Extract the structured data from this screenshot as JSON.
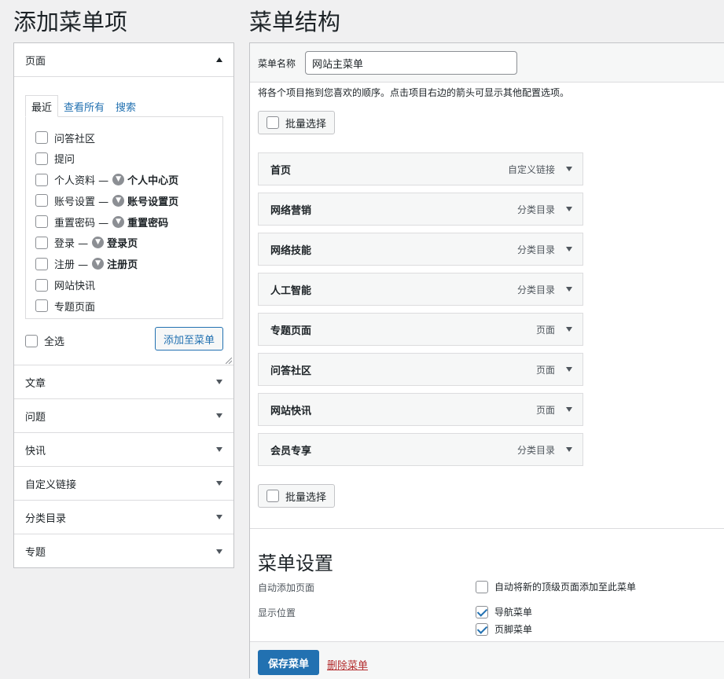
{
  "left": {
    "title": "添加菜单项",
    "pages_section": {
      "heading": "页面",
      "tabs": [
        "最近",
        "查看所有",
        "搜索"
      ],
      "items": [
        {
          "label": "问答社区",
          "checked": false,
          "suffix": ""
        },
        {
          "label": "提问",
          "checked": false,
          "suffix": ""
        },
        {
          "label": "个人资料 —",
          "checked": false,
          "suffix": "个人中心页"
        },
        {
          "label": "账号设置 —",
          "checked": false,
          "suffix": "账号设置页"
        },
        {
          "label": "重置密码 —",
          "checked": false,
          "suffix": "重置密码"
        },
        {
          "label": "登录 —",
          "checked": false,
          "suffix": "登录页"
        },
        {
          "label": "注册 —",
          "checked": false,
          "suffix": "注册页"
        },
        {
          "label": "网站快讯",
          "checked": false,
          "suffix": ""
        },
        {
          "label": "专题页面",
          "checked": false,
          "suffix": ""
        }
      ],
      "select_all": "全选",
      "add_button": "添加至菜单"
    },
    "other_sections": [
      "文章",
      "问题",
      "快讯",
      "自定义链接",
      "分类目录",
      "专题"
    ]
  },
  "right": {
    "title": "菜单结构",
    "menu_name_label": "菜单名称",
    "menu_name_value": "网站主菜单",
    "instructions": "将各个项目拖到您喜欢的顺序。点击项目右边的箭头可显示其他配置选项。",
    "bulk_select": "批量选择",
    "menu_items": [
      {
        "title": "首页",
        "type": "自定义链接"
      },
      {
        "title": "网络营销",
        "type": "分类目录"
      },
      {
        "title": "网络技能",
        "type": "分类目录"
      },
      {
        "title": "人工智能",
        "type": "分类目录"
      },
      {
        "title": "专题页面",
        "type": "页面"
      },
      {
        "title": "问答社区",
        "type": "页面"
      },
      {
        "title": "网站快讯",
        "type": "页面"
      },
      {
        "title": "会员专享",
        "type": "分类目录"
      }
    ],
    "settings": {
      "title": "菜单设置",
      "auto_add_label": "自动添加页面",
      "auto_add_option": "自动将新的顶级页面添加至此菜单",
      "auto_add_checked": false,
      "location_label": "显示位置",
      "locations": [
        {
          "label": "导航菜单",
          "checked": true
        },
        {
          "label": "页脚菜单",
          "checked": true
        }
      ]
    },
    "save_button": "保存菜单",
    "delete_link": "删除菜单"
  },
  "colors": {
    "primary": "#2271b1",
    "danger": "#b32d2e",
    "background": "#f0f0f1"
  }
}
